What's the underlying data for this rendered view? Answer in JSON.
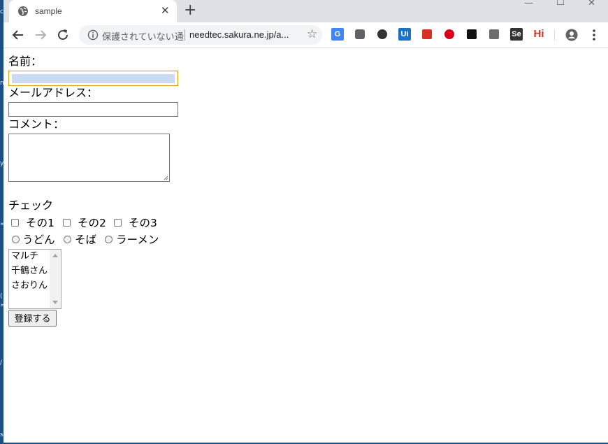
{
  "browser": {
    "tab_title": "sample",
    "new_tab_symbol": "+",
    "security_label": "保護されていない通",
    "url": "needtec.sakura.ne.jp/a...",
    "extensions": [
      {
        "name": "google-translate-icon",
        "text": "G",
        "color": "#4285f4"
      },
      {
        "name": "camera-icon",
        "text": "",
        "color": "#5f6368"
      },
      {
        "name": "spheres-icon",
        "text": "",
        "color": "#333333"
      },
      {
        "name": "ui-icon",
        "text": "Ui",
        "color": "#1a73c7"
      },
      {
        "name": "red-pdf-icon",
        "text": "",
        "color": "#d93025"
      },
      {
        "name": "trend-icon",
        "text": "",
        "color": "#d9001b"
      },
      {
        "name": "black-square-icon",
        "text": "",
        "color": "#111111"
      },
      {
        "name": "thumbs-up-icon",
        "text": "",
        "color": "#6d6d6d"
      },
      {
        "name": "selenium-icon",
        "text": "Se",
        "color": "#333333"
      },
      {
        "name": "hi-icon",
        "text": "Hi",
        "color": "#d93025"
      }
    ]
  },
  "form": {
    "name_label": "名前：",
    "email_label": "メールアドレス：",
    "comment_label": "コメント：",
    "check_heading": "チェック",
    "checkboxes": [
      "その1",
      "その2",
      "その3"
    ],
    "radios": [
      "うどん",
      "そば",
      "ラーメン"
    ],
    "listbox_items": [
      "マルチ",
      "千鶴さん",
      "さおりん"
    ],
    "submit_label": "登録する"
  },
  "colors": {
    "focus_border": "#e59700",
    "focus_fill": "#c9daf2",
    "tabbar_bg": "#dee1e6"
  }
}
